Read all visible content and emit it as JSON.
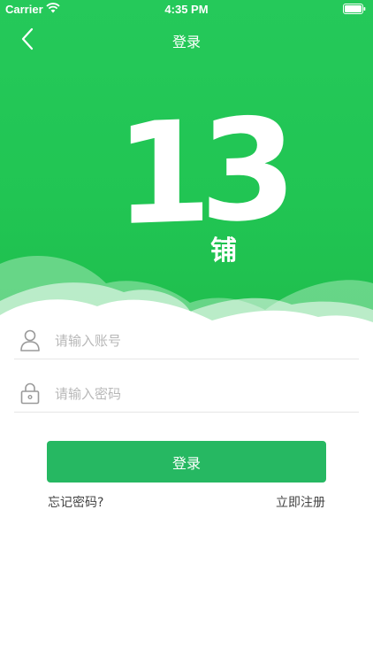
{
  "status_bar": {
    "carrier": "Carrier",
    "time": "4:35 PM"
  },
  "nav": {
    "title": "登录",
    "back_icon": "chevron-left-icon"
  },
  "logo": {
    "number": "13",
    "char": "铺"
  },
  "form": {
    "account_placeholder": "请输入账号",
    "password_placeholder": "请输入密码",
    "account_icon": "user-icon",
    "password_icon": "lock-icon"
  },
  "actions": {
    "login_label": "登录",
    "forgot_label": "忘记密码?",
    "register_label": "立即注册"
  },
  "colors": {
    "hero_green": "#22c55a",
    "button_green": "#26b862"
  }
}
